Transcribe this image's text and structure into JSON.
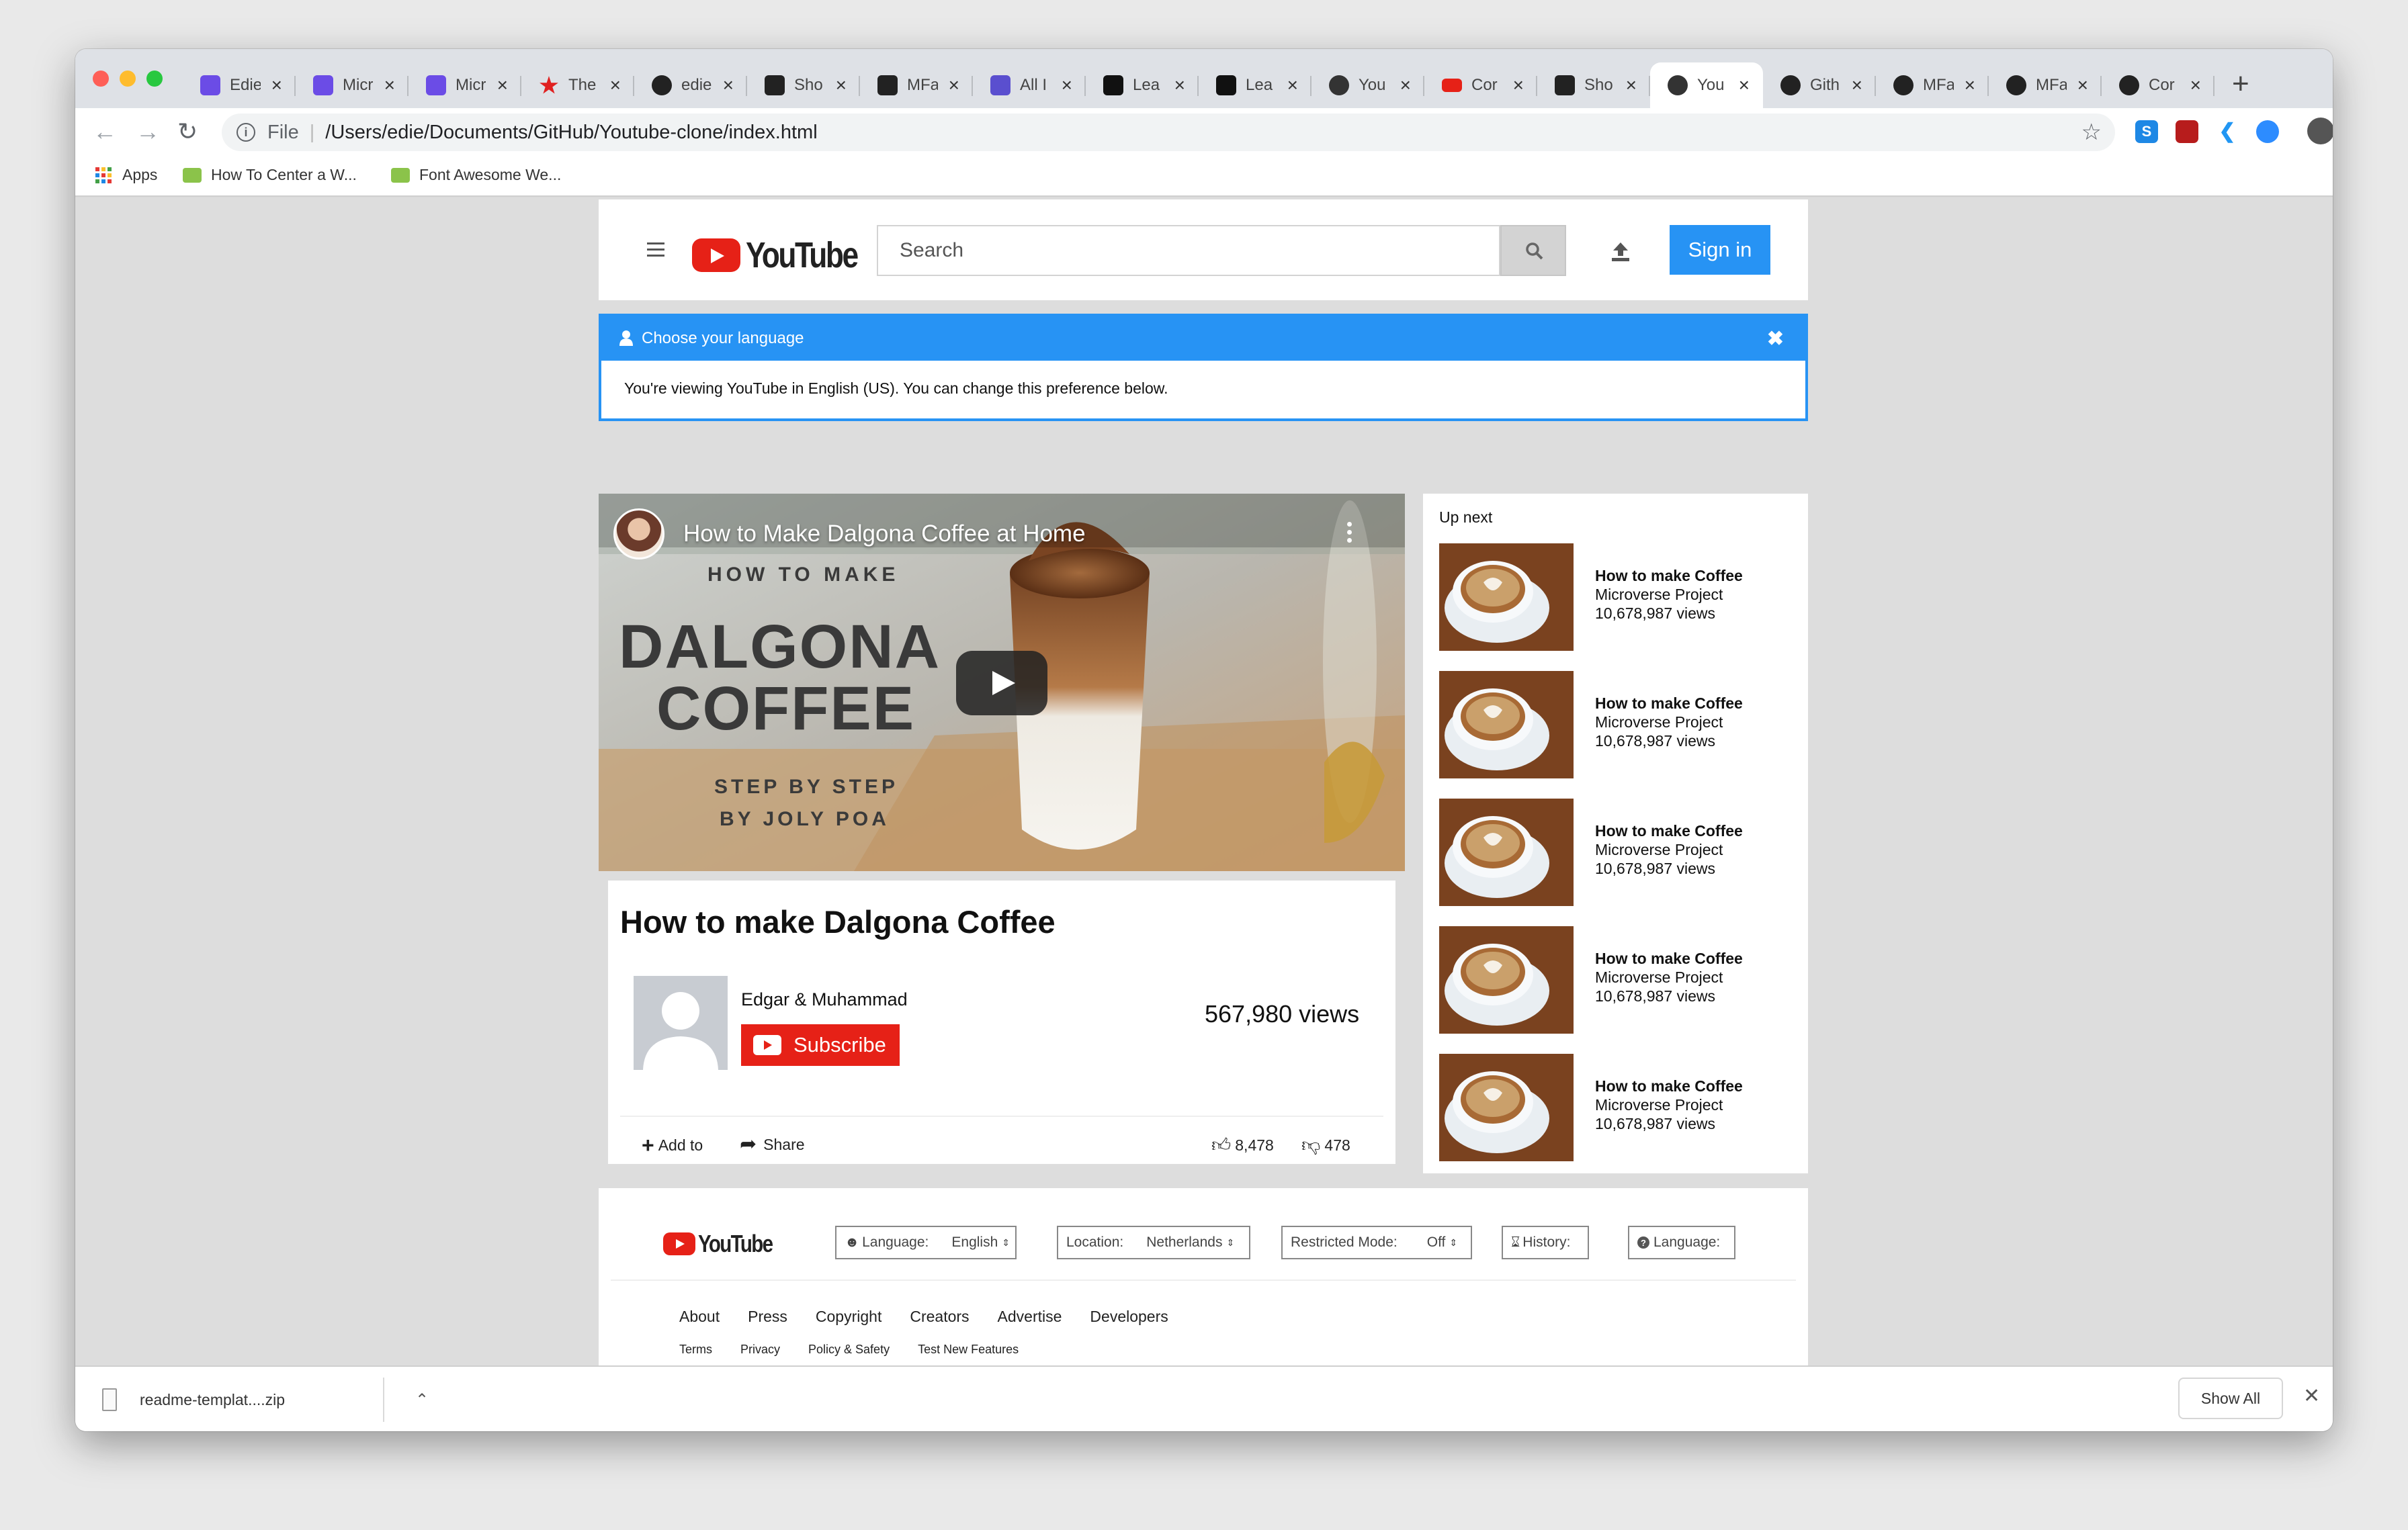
{
  "tabs": [
    {
      "title": "Edie",
      "icon": "microverse-icon",
      "color": "#6b4ce6"
    },
    {
      "title": "Micr",
      "icon": "microverse-icon",
      "color": "#6b4ce6"
    },
    {
      "title": "Micr",
      "icon": "microverse-icon",
      "color": "#6b4ce6"
    },
    {
      "title": "The",
      "icon": "star-icon",
      "color": "#e02020"
    },
    {
      "title": "edie",
      "icon": "github-icon",
      "color": "#222222"
    },
    {
      "title": "Sho",
      "icon": "shortcut-icon",
      "color": "#222222"
    },
    {
      "title": "MFa",
      "icon": "mfa-icon",
      "color": "#222222"
    },
    {
      "title": "All I",
      "icon": "microverse-icon",
      "color": "#5a4fcf"
    },
    {
      "title": "Lea",
      "icon": "learn-icon",
      "color": "#111111"
    },
    {
      "title": "Lea",
      "icon": "learn-icon",
      "color": "#111111"
    },
    {
      "title": "You",
      "icon": "globe-icon",
      "color": "#333333"
    },
    {
      "title": "Cor",
      "icon": "youtube-icon",
      "color": "#e62117"
    },
    {
      "title": "Sho",
      "icon": "shortcut-icon",
      "color": "#222222"
    },
    {
      "title": "You",
      "icon": "globe-icon",
      "color": "#333333",
      "active": true
    },
    {
      "title": "Gith",
      "icon": "github-icon",
      "color": "#222222"
    },
    {
      "title": "MFa",
      "icon": "github-icon",
      "color": "#222222"
    },
    {
      "title": "MFa",
      "icon": "github-icon",
      "color": "#222222"
    },
    {
      "title": "Cor",
      "icon": "github-icon",
      "color": "#222222"
    }
  ],
  "toolbar": {
    "url_scheme": "File",
    "url": "/Users/edie/Documents/GitHub/Youtube-clone/index.html"
  },
  "bookmarks": [
    {
      "label": "Apps",
      "icon": "apps-grid-icon"
    },
    {
      "label": "How To Center a W...",
      "icon": "w3-icon"
    },
    {
      "label": "Font Awesome We...",
      "icon": "w3-icon"
    }
  ],
  "header": {
    "logo_text": "YouTube",
    "search_placeholder": "Search",
    "signin_label": "Sign in"
  },
  "language_banner": {
    "title": "Choose your language",
    "message": "You're viewing YouTube in English (US). You can change this preference below."
  },
  "player": {
    "overlay_title": "How to Make Dalgona Coffee at Home",
    "thumb_line1": "HOW TO MAKE",
    "thumb_line2": "DALGONA",
    "thumb_line3": "COFFEE",
    "thumb_line4": "STEP BY STEP",
    "thumb_line5": "BY JOLY POA"
  },
  "video": {
    "title": "How to make Dalgona Coffee",
    "channel": "Edgar & Muhammad",
    "subscribe_label": "Subscribe",
    "views": "567,980 views",
    "add_to_label": "Add to",
    "share_label": "Share",
    "likes": "8,478",
    "dislikes": "478"
  },
  "up_next": {
    "heading": "Up next",
    "items": [
      {
        "title": "How to make Coffee",
        "channel": "Microverse Project",
        "views": "10,678,987 views"
      },
      {
        "title": "How to make Coffee",
        "channel": "Microverse Project",
        "views": "10,678,987 views"
      },
      {
        "title": "How to make Coffee",
        "channel": "Microverse Project",
        "views": "10,678,987 views"
      },
      {
        "title": "How to make Coffee",
        "channel": "Microverse Project",
        "views": "10,678,987 views"
      },
      {
        "title": "How to make Coffee",
        "channel": "Microverse Project",
        "views": "10,678,987 views"
      }
    ]
  },
  "footer": {
    "logo_text": "YouTube",
    "language_label": "Language:",
    "language_value": "English",
    "location_label": "Location:",
    "location_value": "Netherlands",
    "restricted_label": "Restricted Mode:",
    "restricted_value": "Off",
    "history_label": "History:",
    "help_label": "Language:",
    "links_primary": [
      "About",
      "Press",
      "Copyright",
      "Creators",
      "Advertise",
      "Developers"
    ],
    "links_secondary": [
      "Terms",
      "Privacy",
      "Policy & Safety",
      "Test New Features"
    ]
  },
  "download_bar": {
    "filename": "readme-templat....zip",
    "show_all_label": "Show All"
  },
  "colors": {
    "youtube_red": "#e62117",
    "accent_blue": "#2793f4"
  }
}
